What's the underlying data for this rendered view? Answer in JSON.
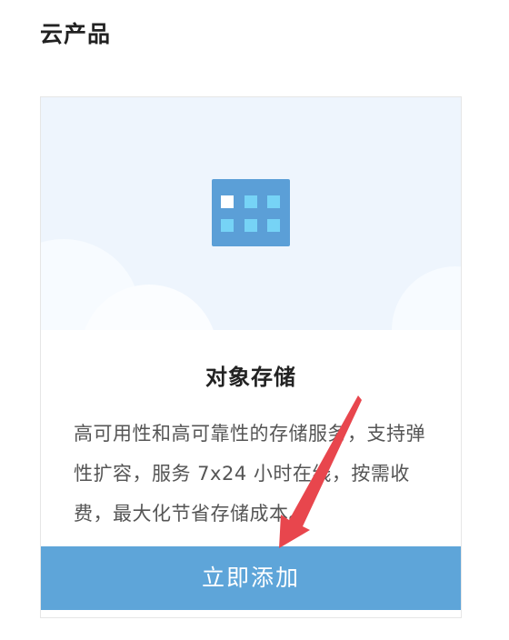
{
  "section": {
    "title": "云产品"
  },
  "card": {
    "icon": "object-storage-grid-icon",
    "name": "对象存储",
    "description": "高可用性和高可靠性的存储服务，支持弹性扩容，服务 7x24 小时在线，按需收费，最大化节省存储成本。",
    "button_label": "立即添加"
  },
  "colors": {
    "accent": "#5ea5d9",
    "hero_background": "#eef5fd",
    "icon_background": "#5b9fd7",
    "icon_cell": "#76d3f6",
    "annotation_arrow": "#e8464d"
  }
}
